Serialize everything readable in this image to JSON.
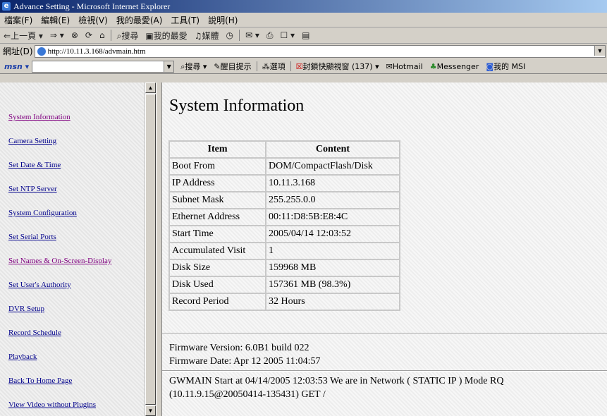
{
  "window": {
    "title": "Advance Setting - Microsoft Internet Explorer"
  },
  "menubar": {
    "items": [
      "檔案(F)",
      "編輯(E)",
      "檢視(V)",
      "我的最愛(A)",
      "工具(T)",
      "說明(H)"
    ]
  },
  "toolbar": {
    "back": "上一頁",
    "search": "搜尋",
    "favorites": "我的最愛",
    "media": "媒體"
  },
  "addressbar": {
    "label": "網址(D)",
    "url": "http://10.11.3.168/advmain.htm"
  },
  "msnbar": {
    "logo": "msn",
    "search": "搜尋",
    "highlight": "醒目提示",
    "options": "選項",
    "popup_blocker": "封鎖快顯視窗 (137)",
    "hotmail": "Hotmail",
    "messenger": "Messenger",
    "my_msn": "我的 MSI"
  },
  "nav": {
    "links": [
      "System Information",
      "Camera Setting",
      "Set Date & Time",
      "Set NTP Server",
      "System Configuration",
      "Set Serial Ports",
      "Set Names & On-Screen-Display",
      "Set User's Authority",
      "DVR Setup",
      "Record Schedule",
      "Playback",
      "Back To Home Page",
      "View Video without Plugins"
    ]
  },
  "main": {
    "title": "System Information",
    "table": {
      "headers": [
        "Item",
        "Content"
      ],
      "rows": [
        [
          "Boot From",
          "DOM/CompactFlash/Disk"
        ],
        [
          "IP Address",
          "10.11.3.168"
        ],
        [
          "Subnet Mask",
          "255.255.0.0"
        ],
        [
          "Ethernet Address",
          "00:11:D8:5B:E8:4C"
        ],
        [
          "Start Time",
          "2005/04/14 12:03:52"
        ],
        [
          "Accumulated Visit",
          "1"
        ],
        [
          "Disk Size",
          "159968 MB"
        ],
        [
          "Disk Used",
          "157361 MB (98.3%)"
        ],
        [
          "Record Period",
          "32 Hours"
        ]
      ]
    },
    "firmware_version": "Firmware Version: 6.0B1 build 022",
    "firmware_date": "Firmware Date: Apr 12 2005 11:04:57",
    "log_line1": "GWMAIN Start at 04/14/2005 12:03:53 We are in Network ( STATIC IP ) Mode RQ",
    "log_line2": "(10.11.9.15@20050414-135431) GET /"
  }
}
